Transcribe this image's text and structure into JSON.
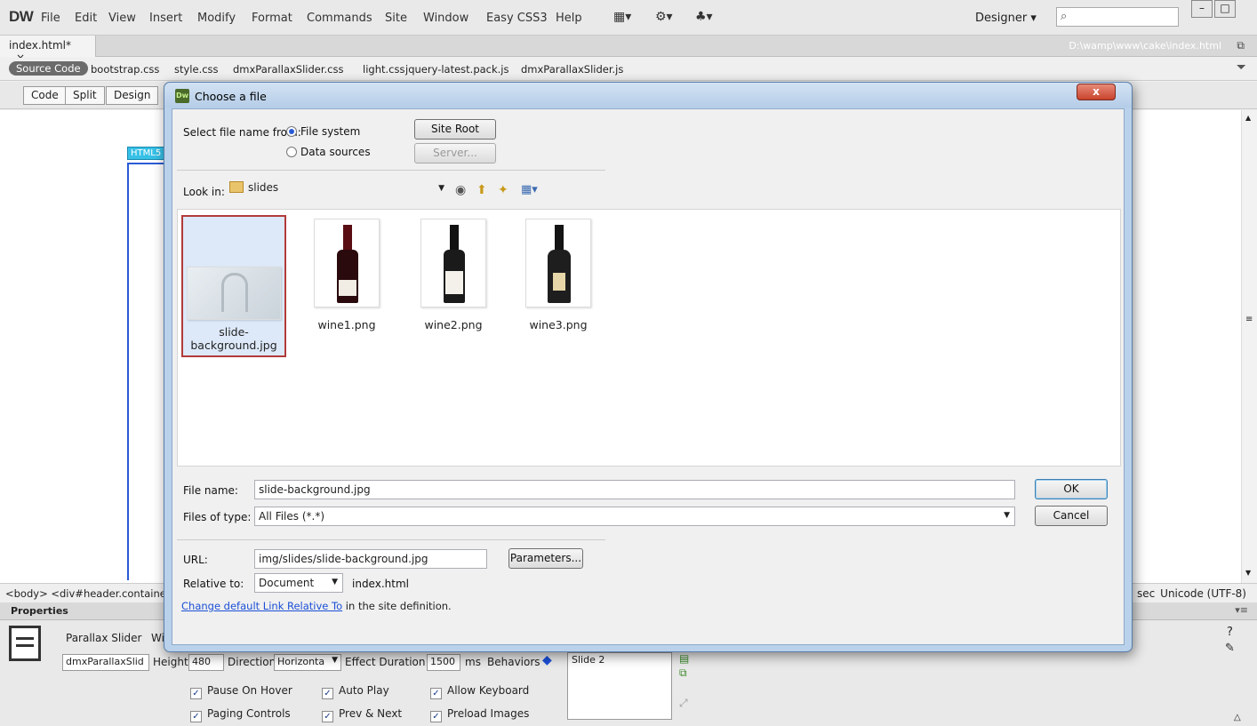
{
  "app": {
    "logo": "DW",
    "menu": [
      "File",
      "Edit",
      "View",
      "Insert",
      "Modify",
      "Format",
      "Commands",
      "Site",
      "Window",
      "Easy CSS3",
      "Help"
    ],
    "workspace": "Designer",
    "workspace_arrow": "▾",
    "search_icon": "⌕"
  },
  "tabs": {
    "doc_tab": "index.html*",
    "close": "×",
    "path": "D:\\wamp\\www\\cake\\index.html"
  },
  "related_files": {
    "source_code": "Source Code",
    "files": [
      "bootstrap.css",
      "style.css",
      "dmxParallaxSlider.css",
      "light.css",
      "jquery-latest.pack.js",
      "dmxParallaxSlider.js"
    ]
  },
  "doc_toolbar": {
    "code": "Code",
    "split": "Split",
    "design": "Design"
  },
  "design_view": {
    "html5_tag": "HTML5"
  },
  "status": {
    "breadcrumb": "<body> <div#header.container",
    "encoding_prefix": "sec",
    "encoding": "Unicode (UTF-8)"
  },
  "properties": {
    "title": "Properties",
    "component_name": "Parallax Slider",
    "w_label": "Wi",
    "id_value": "dmxParallaxSlid",
    "height_label": "Height",
    "height_value": "480",
    "direction_label": "Direction",
    "direction_value": "Horizonta",
    "effect_label": "Effect Duration",
    "effect_value": "1500",
    "effect_unit": "ms",
    "behaviors_label": "Behaviors",
    "slide_item": "Slide 2",
    "checkboxes": [
      {
        "label": "Pause On Hover",
        "checked": true
      },
      {
        "label": "Auto Play",
        "checked": true
      },
      {
        "label": "Allow Keyboard",
        "checked": true
      },
      {
        "label": "Paging Controls",
        "checked": true
      },
      {
        "label": "Prev & Next",
        "checked": true
      },
      {
        "label": "Preload Images",
        "checked": true
      }
    ]
  },
  "dialog": {
    "title": "Choose a file",
    "close": "x",
    "select_from_label": "Select file name from:",
    "file_system": "File system",
    "data_sources": "Data sources",
    "site_root": "Site Root",
    "server": "Server...",
    "look_in_label": "Look in:",
    "look_in_value": "slides",
    "files": [
      "slide-background.jpg",
      "wine1.png",
      "wine2.png",
      "wine3.png"
    ],
    "file_name_label": "File name:",
    "file_name_value": "slide-background.jpg",
    "files_of_type_label": "Files of type:",
    "files_of_type_value": "All Files (*.*)",
    "ok": "OK",
    "cancel": "Cancel",
    "url_label": "URL:",
    "url_value": "img/slides/slide-background.jpg",
    "parameters": "Parameters...",
    "relative_label": "Relative to:",
    "relative_value": "Document",
    "relative_file": "index.html",
    "change_link": "Change default Link Relative To",
    "change_suffix": " in the site definition."
  }
}
